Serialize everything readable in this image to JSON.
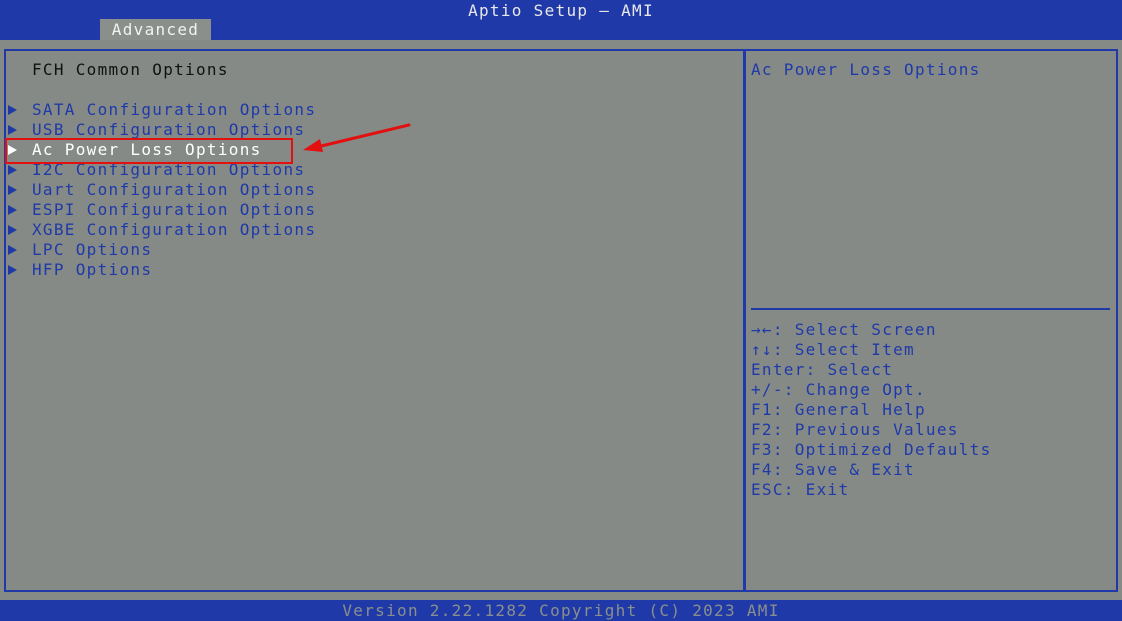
{
  "header": {
    "title": "Aptio Setup – AMI",
    "active_tab": "Advanced"
  },
  "main": {
    "section_title": "FCH Common Options",
    "items": [
      {
        "label": "SATA Configuration Options"
      },
      {
        "label": "USB Configuration Options"
      },
      {
        "label": "Ac Power Loss Options",
        "selected": true
      },
      {
        "label": "I2C Configuration Options"
      },
      {
        "label": "Uart Configuration Options"
      },
      {
        "label": "ESPI Configuration Options"
      },
      {
        "label": "XGBE Configuration Options"
      },
      {
        "label": "LPC Options"
      },
      {
        "label": "HFP Options"
      }
    ]
  },
  "help": {
    "description": "Ac Power Loss Options",
    "keys": [
      "→←: Select Screen",
      "↑↓: Select Item",
      "Enter: Select",
      "+/-: Change Opt.",
      "F1: General Help",
      "F2: Previous Values",
      "F3: Optimized Defaults",
      "F4: Save & Exit",
      "ESC: Exit"
    ]
  },
  "footer": {
    "text": "Version 2.22.1282 Copyright (C) 2023 AMI"
  },
  "colors": {
    "bios_blue": "#1f3aa8",
    "panel_gray": "#858a87",
    "annotation_red": "#e31010"
  }
}
